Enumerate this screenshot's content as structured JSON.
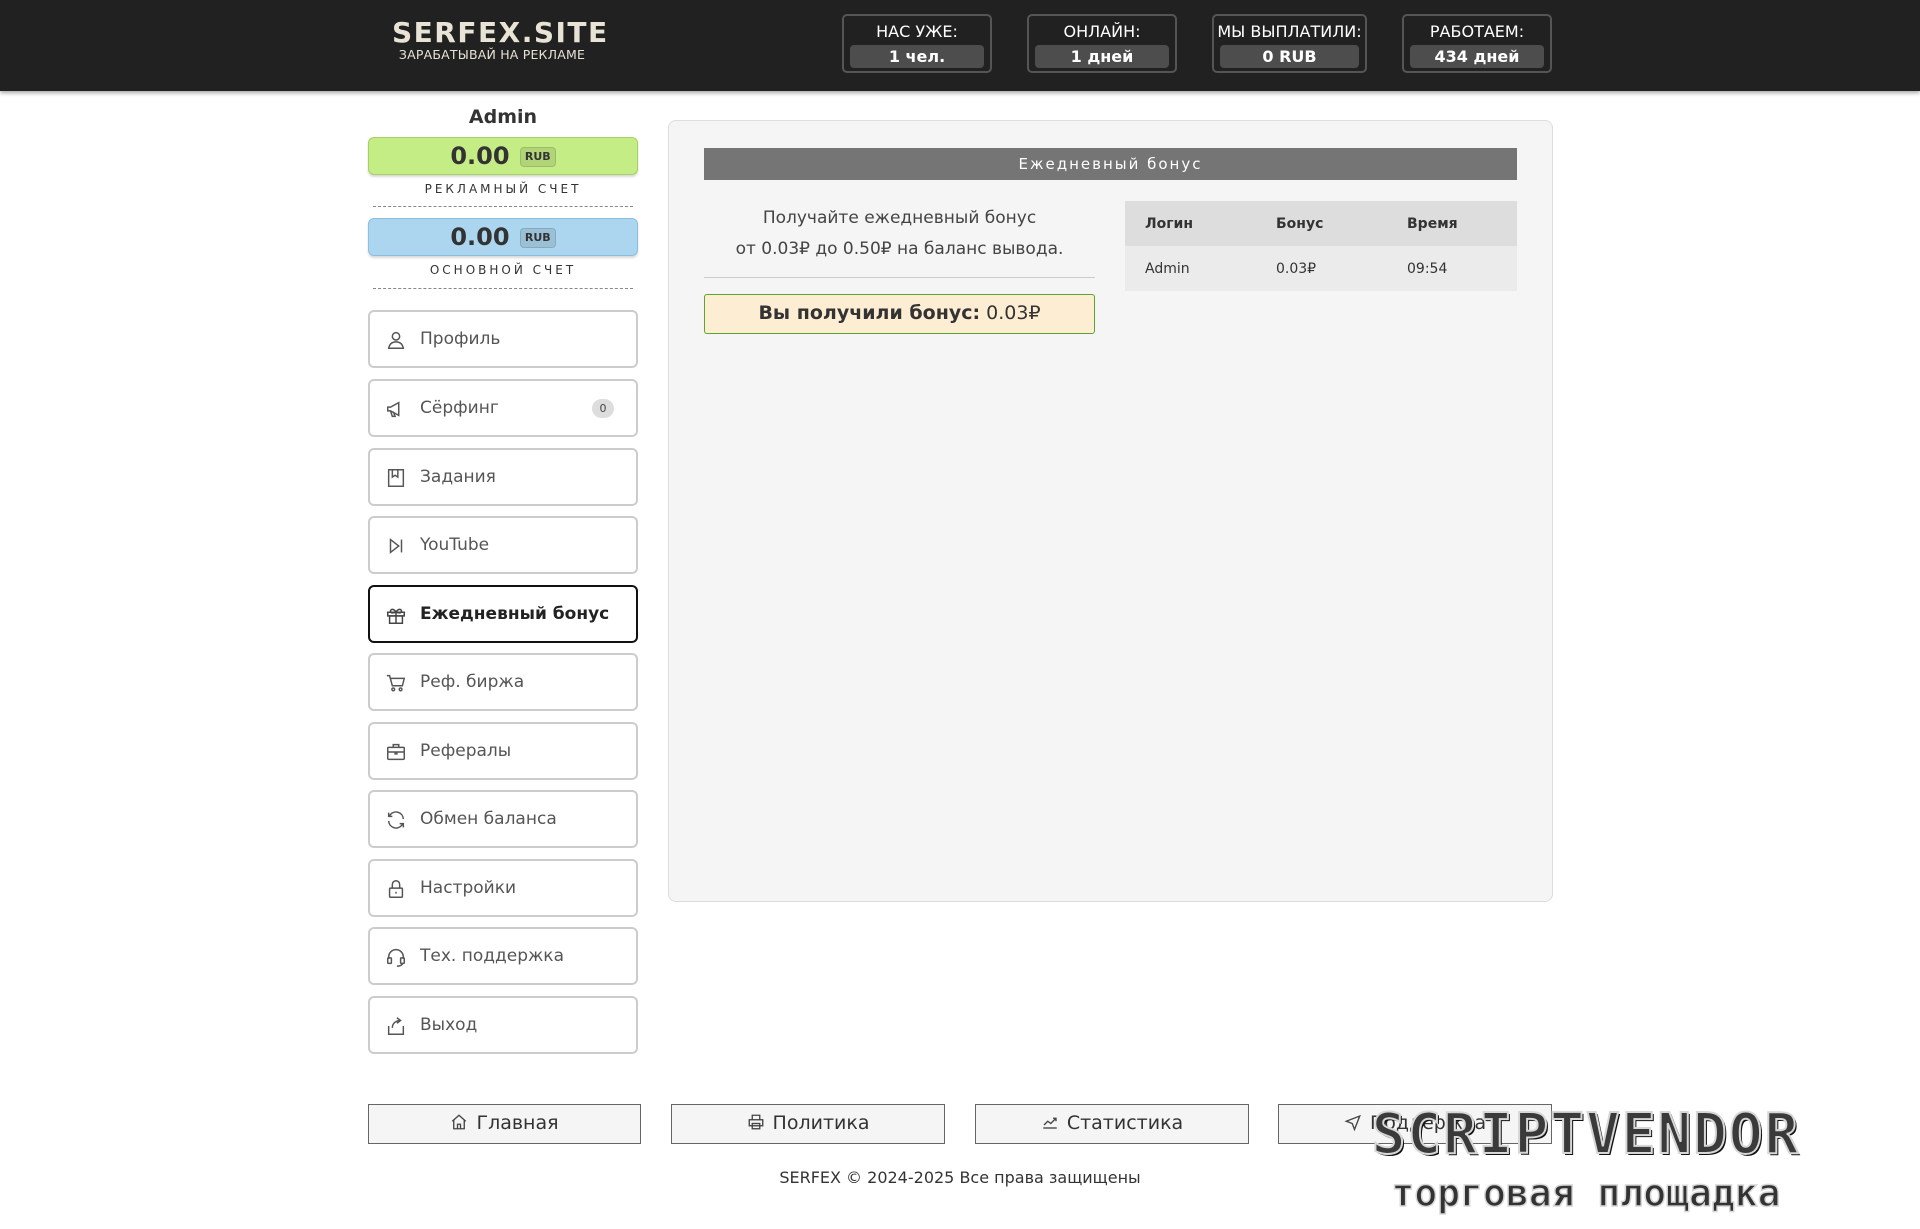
{
  "header": {
    "logo_title": "SERFEX.SITE",
    "logo_subtitle": "ЗАРАБАТЫВАЙ НА РЕКЛАМЕ",
    "stats": [
      {
        "label": "НАС УЖЕ:",
        "value": "1 чел."
      },
      {
        "label": "ОНЛАЙН:",
        "value": "1 дней"
      },
      {
        "label": "МЫ ВЫПЛАТИЛИ:",
        "value": "0 RUB"
      },
      {
        "label": "РАБОТАЕМ:",
        "value": "434 дней"
      }
    ]
  },
  "sidebar": {
    "username": "Admin",
    "ad_balance": {
      "amount": "0.00",
      "currency": "RUB",
      "caption": "РЕКЛАМНЫЙ СЧЕТ"
    },
    "main_balance": {
      "amount": "0.00",
      "currency": "RUB",
      "caption": "ОСНОВНОЙ СЧЕТ"
    },
    "menu": [
      {
        "label": "Профиль",
        "icon": "user-icon"
      },
      {
        "label": "Сёрфинг",
        "icon": "megaphone-icon",
        "badge": "0"
      },
      {
        "label": "Задания",
        "icon": "task-icon"
      },
      {
        "label": "YouTube",
        "icon": "play-icon"
      },
      {
        "label": "Ежедневный бонус",
        "icon": "gift-icon",
        "active": true
      },
      {
        "label": "Реф. биржа",
        "icon": "cart-icon"
      },
      {
        "label": "Рефералы",
        "icon": "briefcase-icon"
      },
      {
        "label": "Обмен баланса",
        "icon": "refresh-icon"
      },
      {
        "label": "Настройки",
        "icon": "lock-icon"
      },
      {
        "label": "Тех. поддержка",
        "icon": "headset-icon"
      },
      {
        "label": "Выход",
        "icon": "exit-icon"
      }
    ]
  },
  "main": {
    "title": "Ежедневный бонус",
    "description_line1": "Получайте ежедневный бонус",
    "description_line2": "от 0.03₽ до 0.50₽ на баланс вывода.",
    "alert_prefix": "Вы получили бонус:",
    "alert_value": "0.03₽",
    "table": {
      "headers": [
        "Логин",
        "Бонус",
        "Время"
      ],
      "rows": [
        [
          "Admin",
          "0.03₽",
          "09:54"
        ]
      ]
    }
  },
  "footer": {
    "buttons": [
      {
        "label": "Главная",
        "icon": "home-icon"
      },
      {
        "label": "Политика",
        "icon": "printer-icon"
      },
      {
        "label": "Статистика",
        "icon": "chart-icon"
      },
      {
        "label": "Поддержка",
        "icon": "send-icon"
      }
    ],
    "copyright": "SERFEX © 2024-2025 Все права защищены"
  },
  "watermark": {
    "title": "SCRIPTVENDOR",
    "subtitle": "торговая площадка"
  }
}
